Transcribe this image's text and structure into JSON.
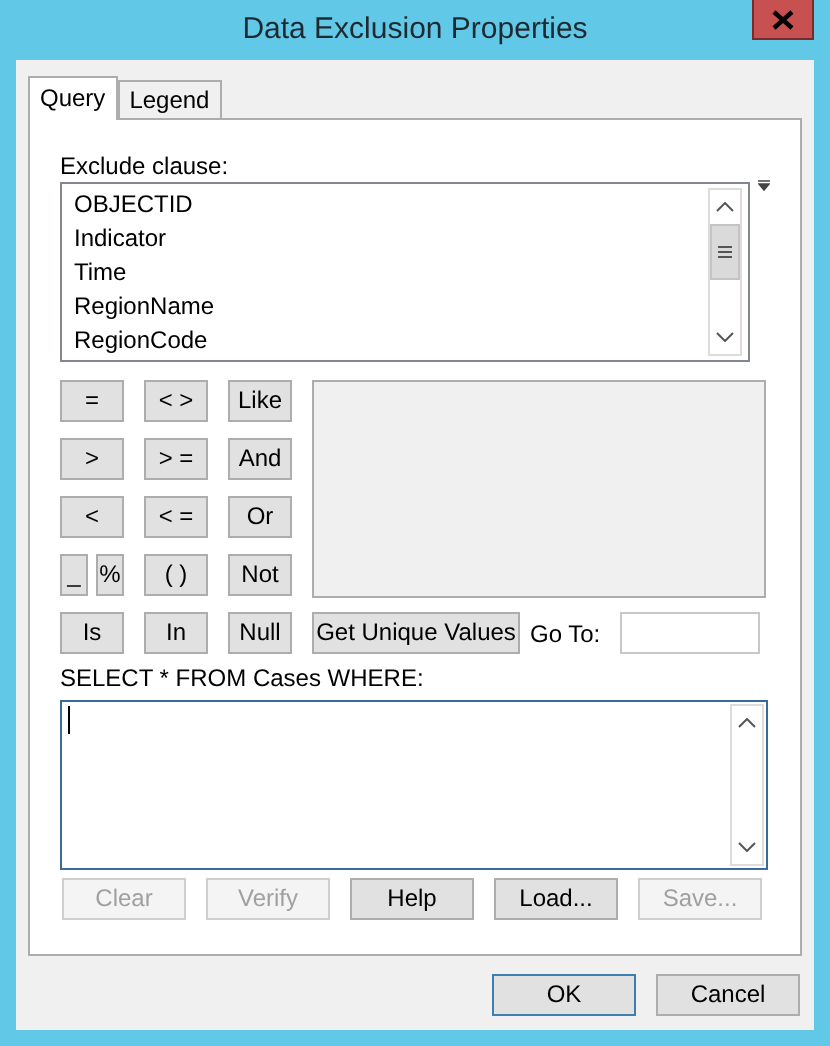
{
  "window": {
    "title": "Data Exclusion Properties"
  },
  "tabs": [
    {
      "label": "Query",
      "selected": true
    },
    {
      "label": "Legend",
      "selected": false
    }
  ],
  "exclude_label": "Exclude clause:",
  "fields": [
    "OBJECTID",
    "Indicator",
    "Time",
    "RegionName",
    "RegionCode"
  ],
  "operator_rows": [
    [
      "=",
      "< >",
      "Like"
    ],
    [
      ">",
      "> =",
      "And"
    ],
    [
      "<",
      "< =",
      "Or"
    ],
    [
      "_",
      "%",
      "( )",
      "Not"
    ],
    [
      "Is",
      "In",
      "Null"
    ]
  ],
  "unique_values_button": "Get Unique Values",
  "goto_label": "Go To:",
  "sql_label": "SELECT * FROM Cases WHERE:",
  "action_buttons": [
    {
      "label": "Clear",
      "disabled": true
    },
    {
      "label": "Verify",
      "disabled": true
    },
    {
      "label": "Help",
      "disabled": false
    },
    {
      "label": "Load...",
      "disabled": false
    },
    {
      "label": "Save...",
      "disabled": true
    }
  ],
  "dialog_buttons": [
    {
      "label": "OK",
      "default": true
    },
    {
      "label": "Cancel",
      "default": false
    }
  ]
}
